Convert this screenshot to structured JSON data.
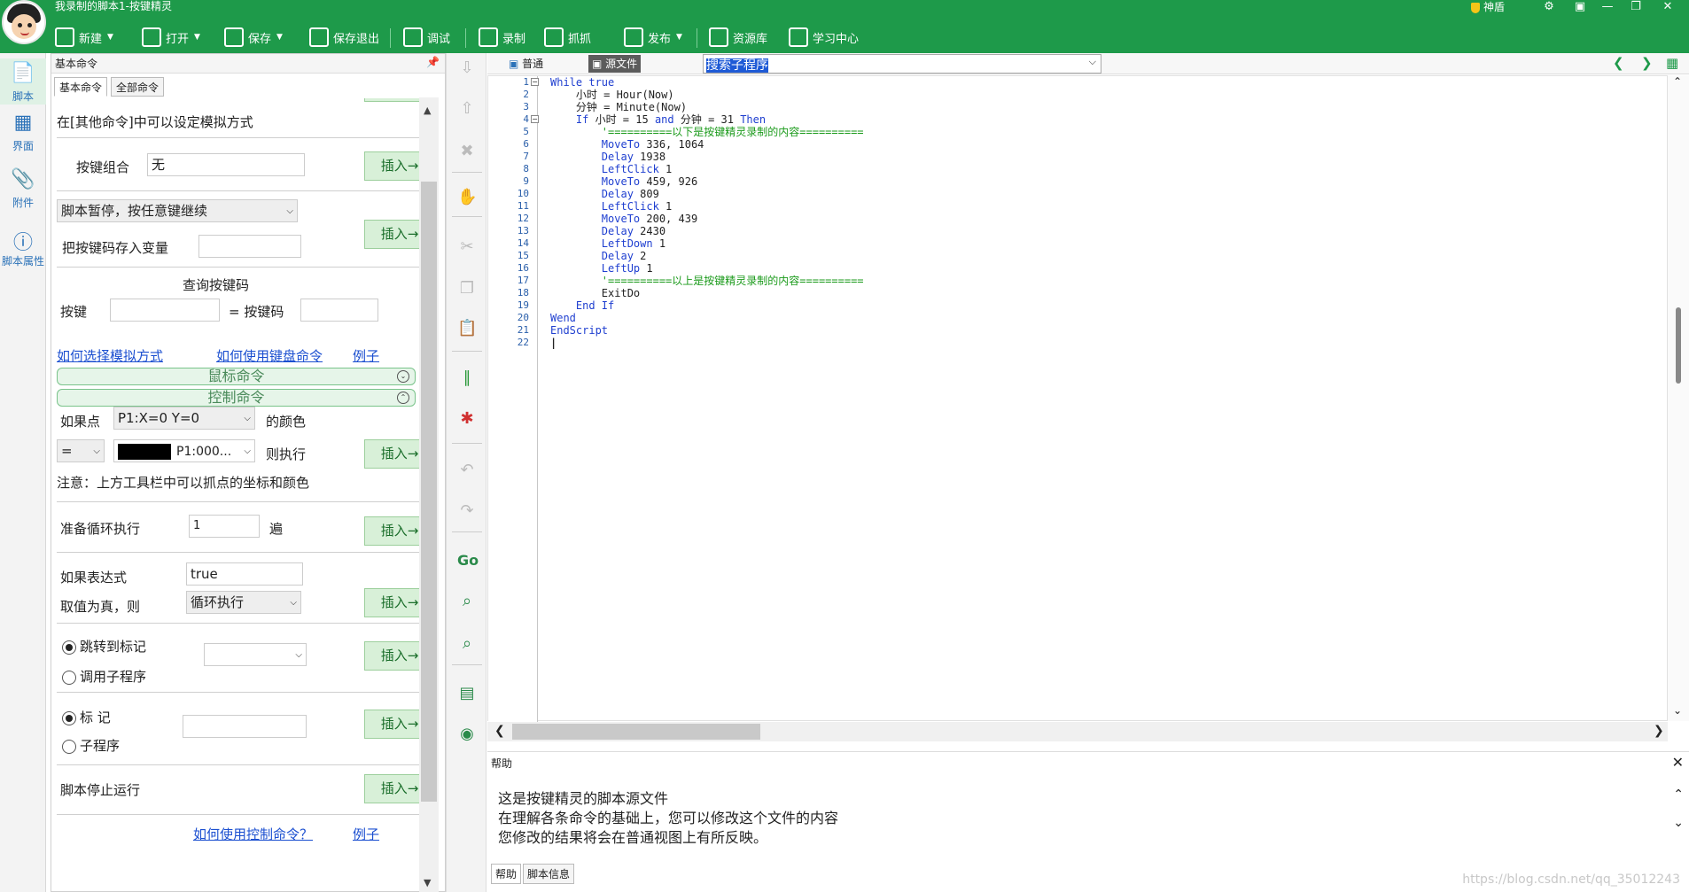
{
  "window": {
    "title": "我录制的脚本1-按键精灵",
    "user": "神盾"
  },
  "toolbar": {
    "items": [
      {
        "label": "新建",
        "icon": "new-icon",
        "dropdown": true
      },
      {
        "label": "打开",
        "icon": "open-folder-icon",
        "dropdown": true
      },
      {
        "label": "保存",
        "icon": "save-icon",
        "dropdown": true
      },
      {
        "label": "保存退出",
        "icon": "save-exit-icon"
      },
      {
        "label": "调试",
        "icon": "play-icon"
      },
      {
        "label": "录制",
        "icon": "camera-icon"
      },
      {
        "label": "抓抓",
        "icon": "grab-icon"
      },
      {
        "label": "发布",
        "icon": "publish-icon",
        "dropdown": true
      },
      {
        "label": "资源库",
        "icon": "resource-icon"
      },
      {
        "label": "学习中心",
        "icon": "learning-icon"
      }
    ]
  },
  "leftnav": {
    "items": [
      {
        "label": "脚本",
        "icon": "script-icon",
        "active": true
      },
      {
        "label": "界面",
        "icon": "ui-grid-icon"
      },
      {
        "label": "附件",
        "icon": "attachment-icon"
      },
      {
        "label": "脚本属性",
        "icon": "info-icon"
      }
    ]
  },
  "cmdpanel": {
    "title": "基本命令",
    "tabs": [
      "基本命令",
      "全部命令"
    ],
    "keyboard": {
      "top_note": "在[其他命令]中可以设定模拟方式",
      "combo_label": "按键组合",
      "combo_value": "无",
      "pause_select": "脚本暂停，按任意键继续",
      "store_label": "把按键码存入变量",
      "query_title": "查询按键码",
      "key_label": "按键",
      "code_label": "= 按键码",
      "links": [
        "如何选择模拟方式",
        "如何使用键盘命令",
        "例子"
      ]
    },
    "sections": {
      "mouse": "鼠标命令",
      "control": "控制命令"
    },
    "control": {
      "if_point_label": "如果点",
      "point_select": "P1:X=0 Y=0",
      "color_label": "的颜色",
      "op_select": "=",
      "color_select": "P1:000...",
      "then_label": "则执行",
      "note": "注意：上方工具栏中可以抓点的坐标和颜色",
      "loop_label": "准备循环执行",
      "loop_value": "1",
      "loop_unit": "遍",
      "expr_label": "如果表达式",
      "expr_value": "true",
      "true_label": "取值为真，则",
      "true_select": "循环执行",
      "goto_label": "跳转到标记",
      "call_label": "调用子程序",
      "mark_label": "标 记",
      "sub_label": "子程序",
      "stop_label": "脚本停止运行",
      "links": [
        "如何使用控制命令？",
        "例子"
      ]
    },
    "insert_label": "插入→"
  },
  "editor": {
    "views": [
      "普通",
      "源文件"
    ],
    "active_view": "源文件",
    "subroutine_search": "搜索子程序",
    "lines": [
      [
        {
          "t": "While true",
          "c": "kw"
        }
      ],
      [
        {
          "t": "    小时 = Hour(Now)",
          "c": ""
        }
      ],
      [
        {
          "t": "    分钟 = Minute(Now)",
          "c": ""
        }
      ],
      [
        {
          "t": "    ",
          "c": ""
        },
        {
          "t": "If",
          "c": "kw"
        },
        {
          "t": " 小时 = 15 ",
          "c": ""
        },
        {
          "t": "and",
          "c": "kw"
        },
        {
          "t": " 分钟 = 31 ",
          "c": ""
        },
        {
          "t": "Then",
          "c": "kw"
        }
      ],
      [
        {
          "t": "        '==========以下是按键精灵录制的内容==========",
          "c": "cmt"
        }
      ],
      [
        {
          "t": "        ",
          "c": ""
        },
        {
          "t": "MoveTo",
          "c": "kw"
        },
        {
          "t": " 336, 1064",
          "c": ""
        }
      ],
      [
        {
          "t": "        ",
          "c": ""
        },
        {
          "t": "Delay",
          "c": "kw"
        },
        {
          "t": " 1938",
          "c": ""
        }
      ],
      [
        {
          "t": "        ",
          "c": ""
        },
        {
          "t": "LeftClick",
          "c": "kw"
        },
        {
          "t": " 1",
          "c": ""
        }
      ],
      [
        {
          "t": "        ",
          "c": ""
        },
        {
          "t": "MoveTo",
          "c": "kw"
        },
        {
          "t": " 459, 926",
          "c": ""
        }
      ],
      [
        {
          "t": "        ",
          "c": ""
        },
        {
          "t": "Delay",
          "c": "kw"
        },
        {
          "t": " 809",
          "c": ""
        }
      ],
      [
        {
          "t": "        ",
          "c": ""
        },
        {
          "t": "LeftClick",
          "c": "kw"
        },
        {
          "t": " 1",
          "c": ""
        }
      ],
      [
        {
          "t": "        ",
          "c": ""
        },
        {
          "t": "MoveTo",
          "c": "kw"
        },
        {
          "t": " 200, 439",
          "c": ""
        }
      ],
      [
        {
          "t": "        ",
          "c": ""
        },
        {
          "t": "Delay",
          "c": "kw"
        },
        {
          "t": " 2430",
          "c": ""
        }
      ],
      [
        {
          "t": "        ",
          "c": ""
        },
        {
          "t": "LeftDown",
          "c": "kw"
        },
        {
          "t": " 1",
          "c": ""
        }
      ],
      [
        {
          "t": "        ",
          "c": ""
        },
        {
          "t": "Delay",
          "c": "kw"
        },
        {
          "t": " 2",
          "c": ""
        }
      ],
      [
        {
          "t": "        ",
          "c": ""
        },
        {
          "t": "LeftUp",
          "c": "kw"
        },
        {
          "t": " 1",
          "c": ""
        }
      ],
      [
        {
          "t": "        '==========以上是按键精灵录制的内容==========",
          "c": "cmt"
        }
      ],
      [
        {
          "t": "        ExitDo",
          "c": ""
        }
      ],
      [
        {
          "t": "    ",
          "c": ""
        },
        {
          "t": "End If",
          "c": "kw"
        }
      ],
      [
        {
          "t": "Wend",
          "c": "kw"
        }
      ],
      [
        {
          "t": "EndScript",
          "c": "kw"
        }
      ],
      [
        {
          "t": "",
          "c": ""
        }
      ]
    ]
  },
  "help": {
    "title": "帮助",
    "lines": [
      "这是按键精灵的脚本源文件",
      "在理解各条命令的基础上，您可以修改这个文件的内容",
      "您修改的结果将会在普通视图上有所反映。"
    ],
    "tabs": [
      "帮助",
      "脚本信息"
    ]
  },
  "watermark": "https://blog.csdn.net/qq_35012243",
  "colors": {
    "brand": "#1e9a4a",
    "keyword": "#1f3fd0",
    "comment": "#1a9a1a"
  }
}
